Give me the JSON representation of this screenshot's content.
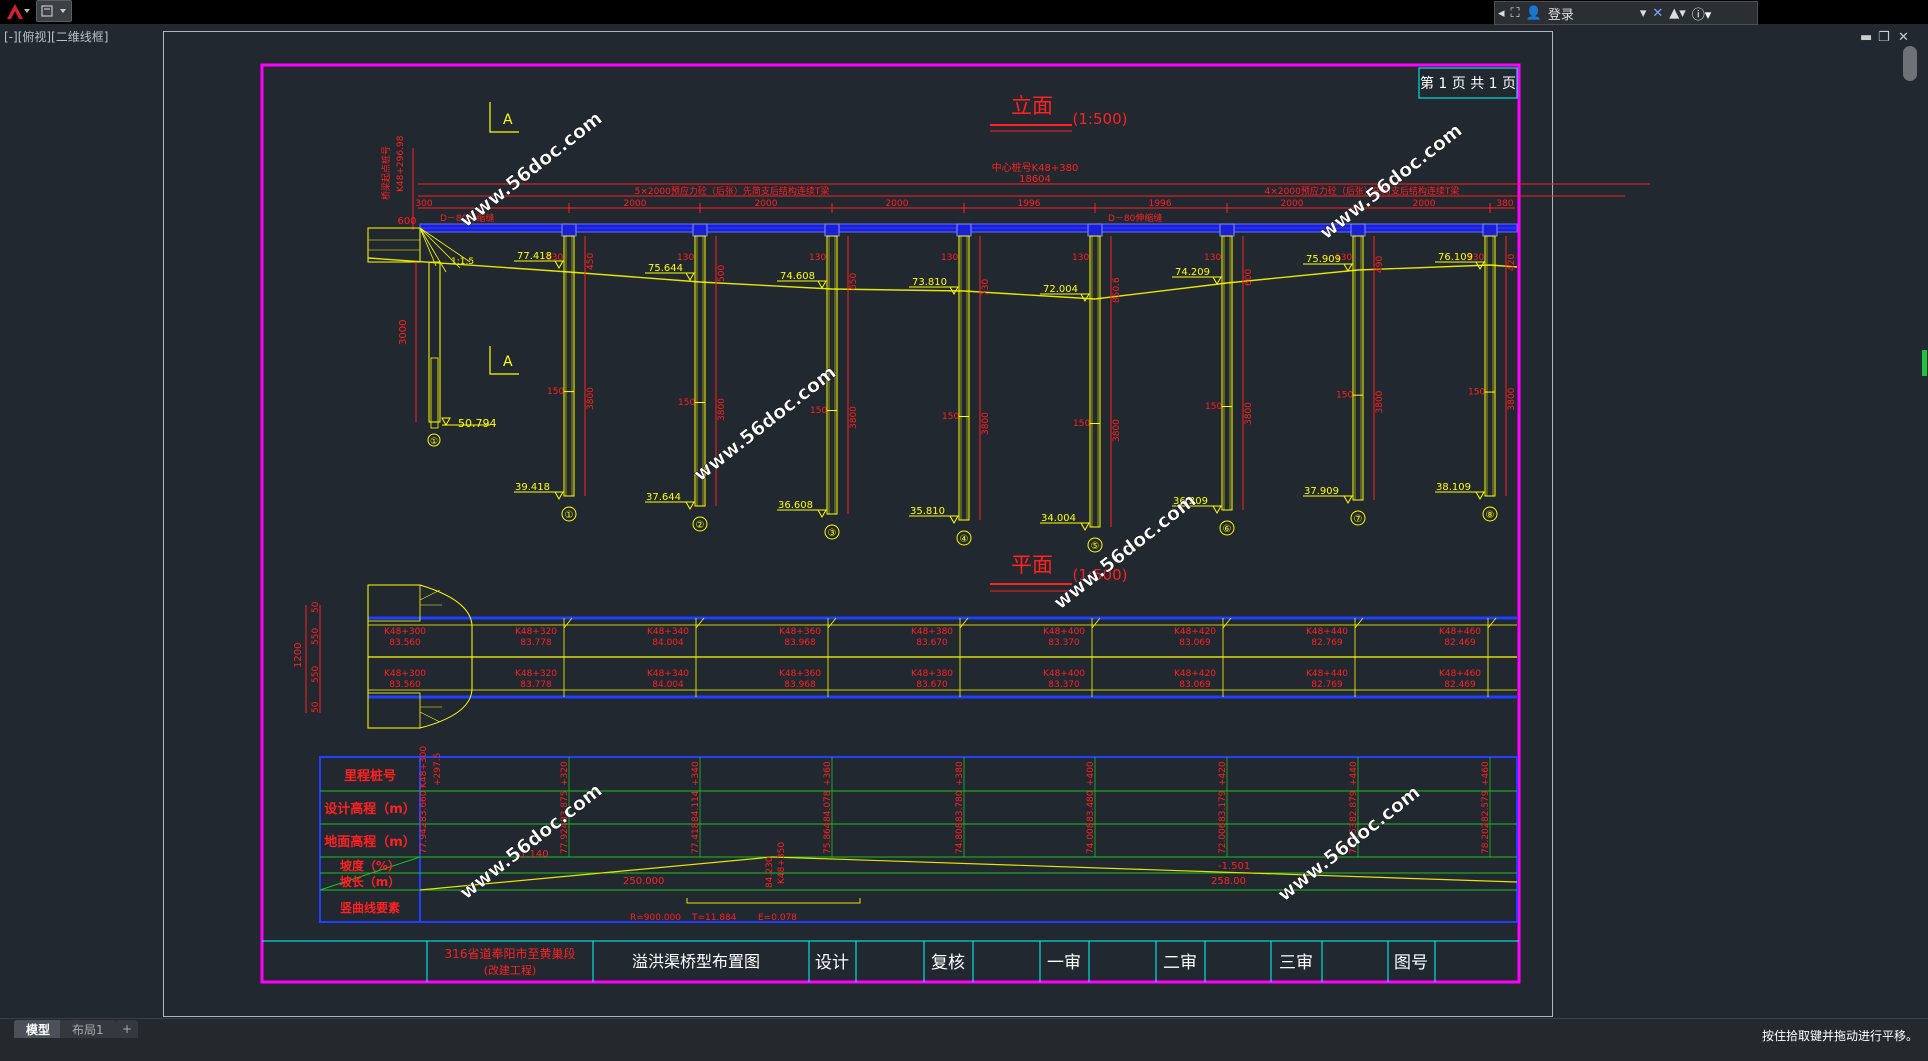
{
  "app": {
    "view_label": "[-][俯视][二维线框]",
    "login_label": "登录",
    "tabs": [
      "模型",
      "布局1"
    ],
    "add_tab": "+",
    "status_text": "按住拾取键并拖动进行平移。"
  },
  "drawing": {
    "page_label": "第 1 页 共 1 页",
    "elevation_title": "立面",
    "elevation_scale": "(1:500)",
    "plan_title": "平面",
    "plan_scale": "(1:500)",
    "section_mark": "A",
    "center_station_label": "中心桩号K48+380",
    "overall_length": "18604",
    "span_note_left": "5×2000预应力砼（后张）先简支后结构连续T梁",
    "span_note_right": "4×2000预应力砼（后张）先简支后结构连续T梁",
    "dim_segments": [
      "300",
      "600",
      "2000",
      "2000",
      "1996",
      "1996",
      "2000",
      "2000",
      "380"
    ],
    "joint_left": "D－80伸缩缝",
    "joint_mid": "D－80伸缩缝",
    "start_station": "K48+296.98",
    "start_note": "桥梁起点桩号",
    "abutment_dim": "3000",
    "abutment_slope": "1:1.5",
    "abutment_top": "77.418",
    "abutment_bottom": "50.794",
    "abutment_id": "①",
    "piers": [
      {
        "id": "①",
        "top": "77.418",
        "bottom": "39.418",
        "dims": [
          "130",
          "150",
          "3800",
          "450"
        ]
      },
      {
        "id": "②",
        "top": "75.644",
        "bottom": "37.644",
        "dims": [
          "130",
          "150",
          "3800",
          "500"
        ]
      },
      {
        "id": "③",
        "top": "74.608",
        "bottom": "36.608",
        "dims": [
          "130",
          "150",
          "3800",
          "650"
        ]
      },
      {
        "id": "④",
        "top": "73.810",
        "bottom": "35.810",
        "dims": [
          "130",
          "150",
          "3800",
          "730"
        ]
      },
      {
        "id": "⑤",
        "top": "72.004",
        "bottom": "34.004",
        "dims": [
          "130",
          "150",
          "3800",
          "850.6"
        ]
      },
      {
        "id": "⑥",
        "top": "74.209",
        "bottom": "36.209",
        "dims": [
          "130",
          "150",
          "3800",
          "600"
        ]
      },
      {
        "id": "⑦",
        "top": "75.909",
        "bottom": "37.909",
        "dims": [
          "130",
          "150",
          "3800",
          "490"
        ]
      },
      {
        "id": "⑧",
        "top": "76.109",
        "bottom": "38.109",
        "dims": [
          "130",
          "150",
          "3800",
          "420"
        ]
      }
    ],
    "plan_dims": [
      "50",
      "1200",
      "550",
      "550",
      "50"
    ],
    "plan_upper": [
      {
        "sta": "K48+300",
        "el": "83.560"
      },
      {
        "sta": "K48+320",
        "el": "83.778"
      },
      {
        "sta": "K48+340",
        "el": "84.004"
      },
      {
        "sta": "K48+360",
        "el": "83.968"
      },
      {
        "sta": "K48+380",
        "el": "83.670"
      },
      {
        "sta": "K48+400",
        "el": "83.370"
      },
      {
        "sta": "K48+420",
        "el": "83.069"
      },
      {
        "sta": "K48+440",
        "el": "82.769"
      },
      {
        "sta": "K48+460",
        "el": "82.469"
      }
    ],
    "plan_lower": [
      {
        "sta": "K48+300",
        "el": "83.560"
      },
      {
        "sta": "K48+320",
        "el": "83.778"
      },
      {
        "sta": "K48+340",
        "el": "84.004"
      },
      {
        "sta": "K48+360",
        "el": "83.968"
      },
      {
        "sta": "K48+380",
        "el": "83.670"
      },
      {
        "sta": "K48+400",
        "el": "83.370"
      },
      {
        "sta": "K48+420",
        "el": "83.069"
      },
      {
        "sta": "K48+440",
        "el": "82.769"
      },
      {
        "sta": "K48+460",
        "el": "82.469"
      }
    ],
    "profile_rows": [
      "里程桩号",
      "设计高程（m）",
      "地面高程（m）",
      "坡度（%）",
      "坡长（m）",
      "竖曲线要素"
    ],
    "profile_stations": [
      "K48+300",
      "+297.5",
      "+320",
      "+340",
      "+360",
      "+380",
      "+400",
      "+420",
      "+440",
      "+460"
    ],
    "profile_design": [
      "83.660",
      "+300",
      "83.875",
      "84.114",
      "84.078",
      "83.780",
      "83.480",
      "83.179",
      "82.879",
      "82.579"
    ],
    "profile_ground": [
      "77.924",
      "+300",
      "77.418",
      "75.644",
      "74.608",
      "73.810",
      "72.004",
      "74.209",
      "75.909",
      "76.109"
    ],
    "profile_ground_display": [
      "77.942",
      "77.924",
      "77.418",
      "75.864",
      "74.808",
      "74.008",
      "72.006",
      "74.453",
      "78.202",
      "76.538"
    ],
    "grade_left": "1.140",
    "grade_right": "-1.501",
    "length_left": "250.000",
    "length_right": "258.00",
    "pvi_station": "K48+350",
    "pvi_elev": "84.230",
    "curve_r": "R=900.000",
    "curve_t": "T=11.884",
    "curve_e": "E=0.078",
    "tb_project": "316省道奉阳市至黄巢段",
    "tb_project2": "(改建工程)",
    "tb_title": "溢洪渠桥型布置图",
    "tb_cells": [
      "设计",
      "复核",
      "一审",
      "二审",
      "三审",
      "图号"
    ],
    "watermark": "www.56doc.com"
  }
}
